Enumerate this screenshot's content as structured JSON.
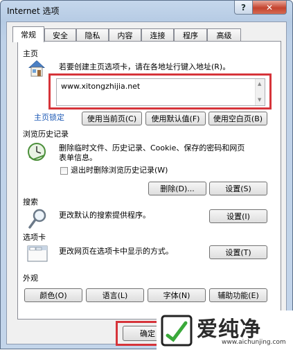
{
  "window": {
    "title": "Internet 选项",
    "help": "?",
    "close": "✕"
  },
  "tabs": [
    {
      "label": "常规",
      "active": true
    },
    {
      "label": "安全"
    },
    {
      "label": "隐私"
    },
    {
      "label": "内容"
    },
    {
      "label": "连接"
    },
    {
      "label": "程序"
    },
    {
      "label": "高级"
    }
  ],
  "homepage": {
    "section": "主页",
    "description": "若要创建主页选项卡，请在各地址行键入地址(R)。",
    "url": "www.xitongzhijia.net",
    "lock_link": "主页锁定",
    "btn_current": "使用当前页(C)",
    "btn_default": "使用默认值(F)",
    "btn_blank": "使用空白页(B)"
  },
  "history": {
    "section": "浏览历史记录",
    "description_line1": "删除临时文件、历史记录、Cookie、保存的密码和网页",
    "description_line2": "表单信息。",
    "checkbox_label": "退出时删除浏览历史记录(W)",
    "btn_delete": "删除(D)...",
    "btn_settings": "设置(S)"
  },
  "search": {
    "section": "搜索",
    "description": "更改默认的搜索提供程序。",
    "btn_settings": "设置(I)"
  },
  "tabs_section": {
    "section": "选项卡",
    "description": "更改网页在选项卡中显示的方式。",
    "btn_settings": "设置(T)"
  },
  "appearance": {
    "section": "外观",
    "btn_colors": "颜色(O)",
    "btn_languages": "语言(L)",
    "btn_fonts": "字体(N)",
    "btn_accessibility": "辅助功能(E)"
  },
  "footer": {
    "ok": "确定"
  },
  "watermark": {
    "brand": "爱纯净",
    "url": "www.aichunjing.com"
  },
  "colors": {
    "highlight": "#d6343a",
    "link": "#1a57b4"
  }
}
